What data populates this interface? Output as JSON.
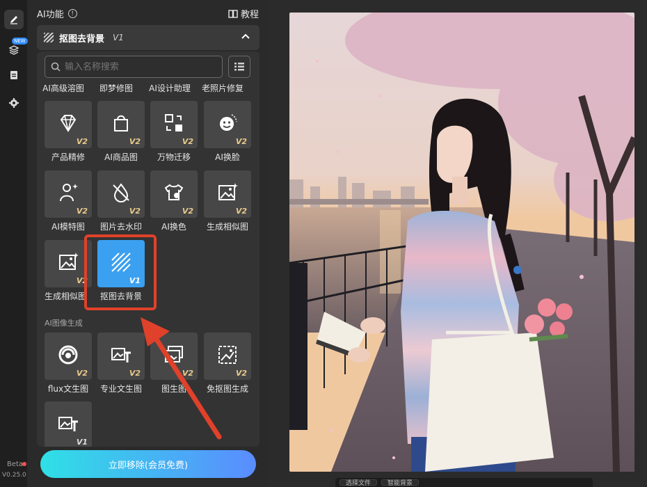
{
  "rail": {
    "new_badge": "NEW",
    "beta": "Beta",
    "version": "V0.25.0"
  },
  "panel": {
    "title": "AI功能",
    "tutorial": "教程",
    "section": {
      "label": "抠图去背景",
      "version": "V1"
    },
    "search": {
      "placeholder": "输入名称搜索"
    },
    "top_row_labels": [
      "AI高级溶图",
      "即梦修图",
      "AI设计助理",
      "老照片修复"
    ],
    "tools": [
      {
        "label": "产品精修",
        "version": "V2",
        "icon": "diamond-sparkle-icon"
      },
      {
        "label": "AI商品图",
        "version": "V2",
        "icon": "shopping-bag-icon"
      },
      {
        "label": "万物迁移",
        "version": "V2",
        "icon": "transfer-icon"
      },
      {
        "label": "AI换脸",
        "version": "V2",
        "icon": "face-swap-icon"
      },
      {
        "label": "AI模特图",
        "version": "V2",
        "icon": "model-person-icon"
      },
      {
        "label": "图片去水印",
        "version": "V2",
        "icon": "watermark-remove-icon"
      },
      {
        "label": "AI换色",
        "version": "V2",
        "icon": "recolor-tshirt-icon"
      },
      {
        "label": "生成相似图",
        "version": "V2",
        "icon": "similar-image-icon"
      },
      {
        "label": "生成相似图",
        "version": "V2",
        "icon": "similar-image-icon"
      },
      {
        "label": "抠图去背景",
        "version": "V1",
        "icon": "cutout-hatch-icon"
      }
    ],
    "category": "AI图像生成",
    "gen_tools": [
      {
        "label": "flux文生图",
        "version": "V2",
        "icon": "flux-swirl-icon"
      },
      {
        "label": "专业文生图",
        "version": "V2",
        "icon": "text-to-image-icon"
      },
      {
        "label": "图生图",
        "version": "V2",
        "icon": "image-to-image-icon"
      },
      {
        "label": "免抠图生成",
        "version": "V2",
        "icon": "no-cutout-icon"
      },
      {
        "label": "",
        "version": "V1",
        "icon": "text-to-image-icon"
      }
    ],
    "cta": "立即移除(会员免费)"
  },
  "canvas": {
    "bottom_bar": [
      "选择文件",
      "智能背景"
    ]
  },
  "colors": {
    "accent": "#3ba0f0",
    "highlight": "#e0412a",
    "v2_badge": "#e9c98a"
  }
}
